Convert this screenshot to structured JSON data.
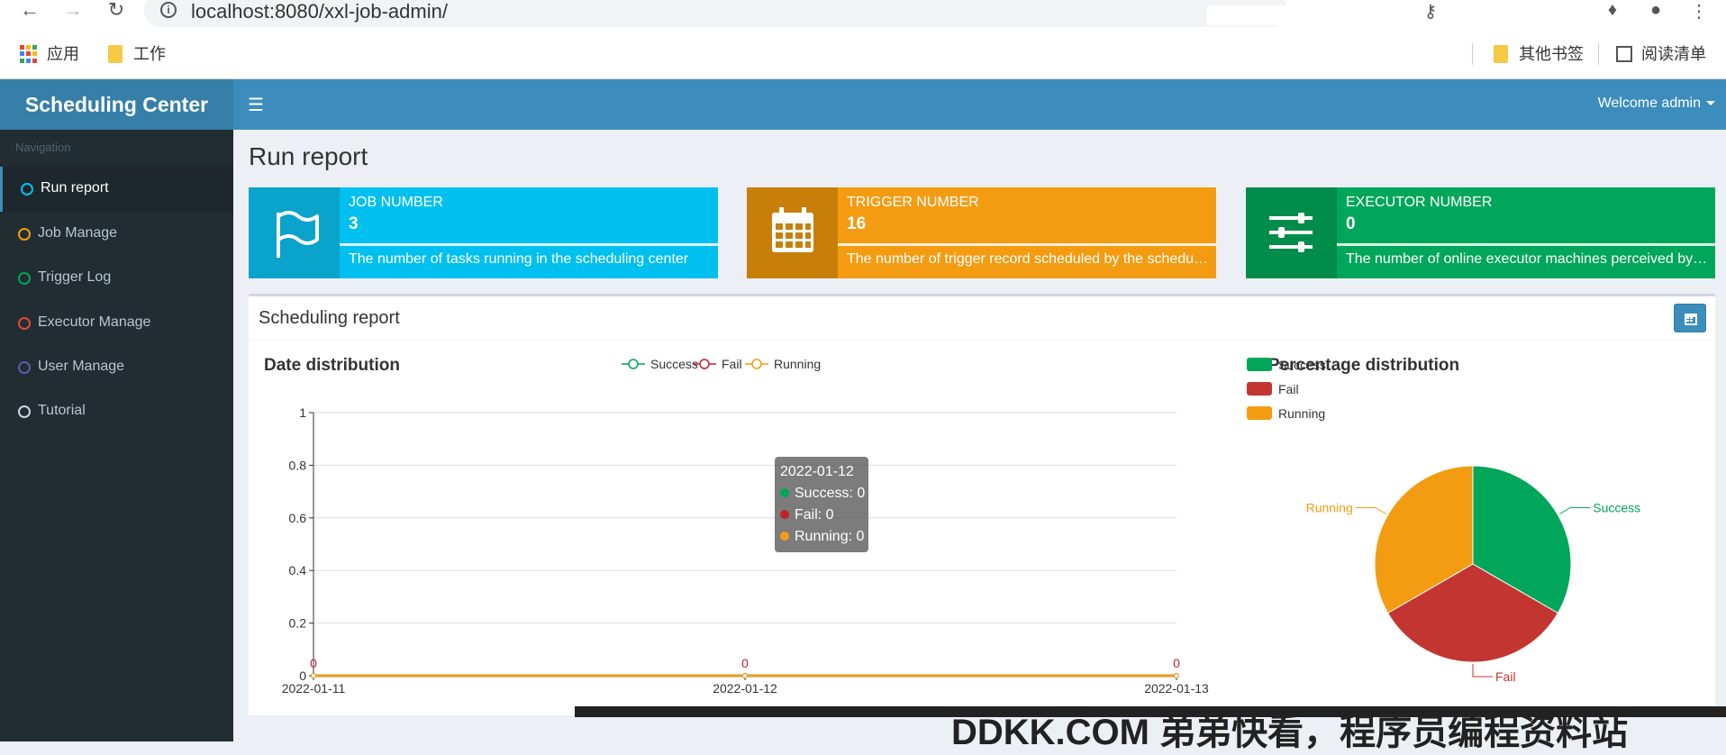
{
  "browser": {
    "url": "localhost:8080/xxl-job-admin/",
    "bookmarks": {
      "apps": "应用",
      "work": "工作",
      "other": "其他书签",
      "reading_list": "阅读清单"
    }
  },
  "header": {
    "logo": "Scheduling Center",
    "welcome": "Welcome admin"
  },
  "sidebar": {
    "header": "Navigation",
    "items": [
      {
        "label": "Run report",
        "color": "#00c0ef"
      },
      {
        "label": "Job Manage",
        "color": "#f39c12"
      },
      {
        "label": "Trigger Log",
        "color": "#00a65a"
      },
      {
        "label": "Executor Manage",
        "color": "#dd4b39"
      },
      {
        "label": "User Manage",
        "color": "#605ca8"
      },
      {
        "label": "Tutorial",
        "color": "#d2d6de"
      }
    ]
  },
  "page": {
    "title": "Run report"
  },
  "info_boxes": [
    {
      "label": "JOB NUMBER",
      "number": "3",
      "description": "The number of tasks running in the scheduling center",
      "color": "#00c0ef",
      "icon_color": "#0aa3cc",
      "icon": "flag-icon"
    },
    {
      "label": "TRIGGER NUMBER",
      "number": "16",
      "description": "The number of trigger record scheduled by the scheduling center",
      "color": "#f39c12",
      "icon_color": "#c87f0a",
      "icon": "calendar-icon"
    },
    {
      "label": "EXECUTOR NUMBER",
      "number": "0",
      "description": "The number of online executor machines perceived by the scheduling center",
      "color": "#00a65a",
      "icon_color": "#008d4c",
      "icon": "sliders-icon"
    }
  ],
  "report": {
    "title": "Scheduling report"
  },
  "chart_data": [
    {
      "type": "line",
      "title": "Date distribution",
      "x": [
        "2022-01-11",
        "2022-01-12",
        "2022-01-13"
      ],
      "series": [
        {
          "name": "Success",
          "values": [
            0,
            0,
            0
          ],
          "color": "#00a65a"
        },
        {
          "name": "Fail",
          "values": [
            0,
            0,
            0
          ],
          "color": "#c1232b"
        },
        {
          "name": "Running",
          "values": [
            0,
            0,
            0
          ],
          "color": "#f39c12"
        }
      ],
      "ylim": [
        0,
        1
      ],
      "yticks": [
        "0",
        "0.2",
        "0.4",
        "0.6",
        "0.8",
        "1"
      ],
      "data_labels": [
        "0",
        "0",
        "0"
      ],
      "legend": "top",
      "grid": true,
      "tooltip": {
        "date": "2022-01-12",
        "lines": [
          "Success: 0",
          "Fail: 0",
          "Running: 0"
        ]
      }
    },
    {
      "type": "pie",
      "title": "Percentage distribution",
      "categories": [
        "Success",
        "Fail",
        "Running"
      ],
      "values": [
        1,
        1,
        1
      ],
      "colors": [
        "#00a65a",
        "#c23531",
        "#f39c12"
      ],
      "legend": "top-left"
    }
  ],
  "watermark": {
    "text": "DDKK.COM 弟弟快看，程序员编程资料站"
  }
}
